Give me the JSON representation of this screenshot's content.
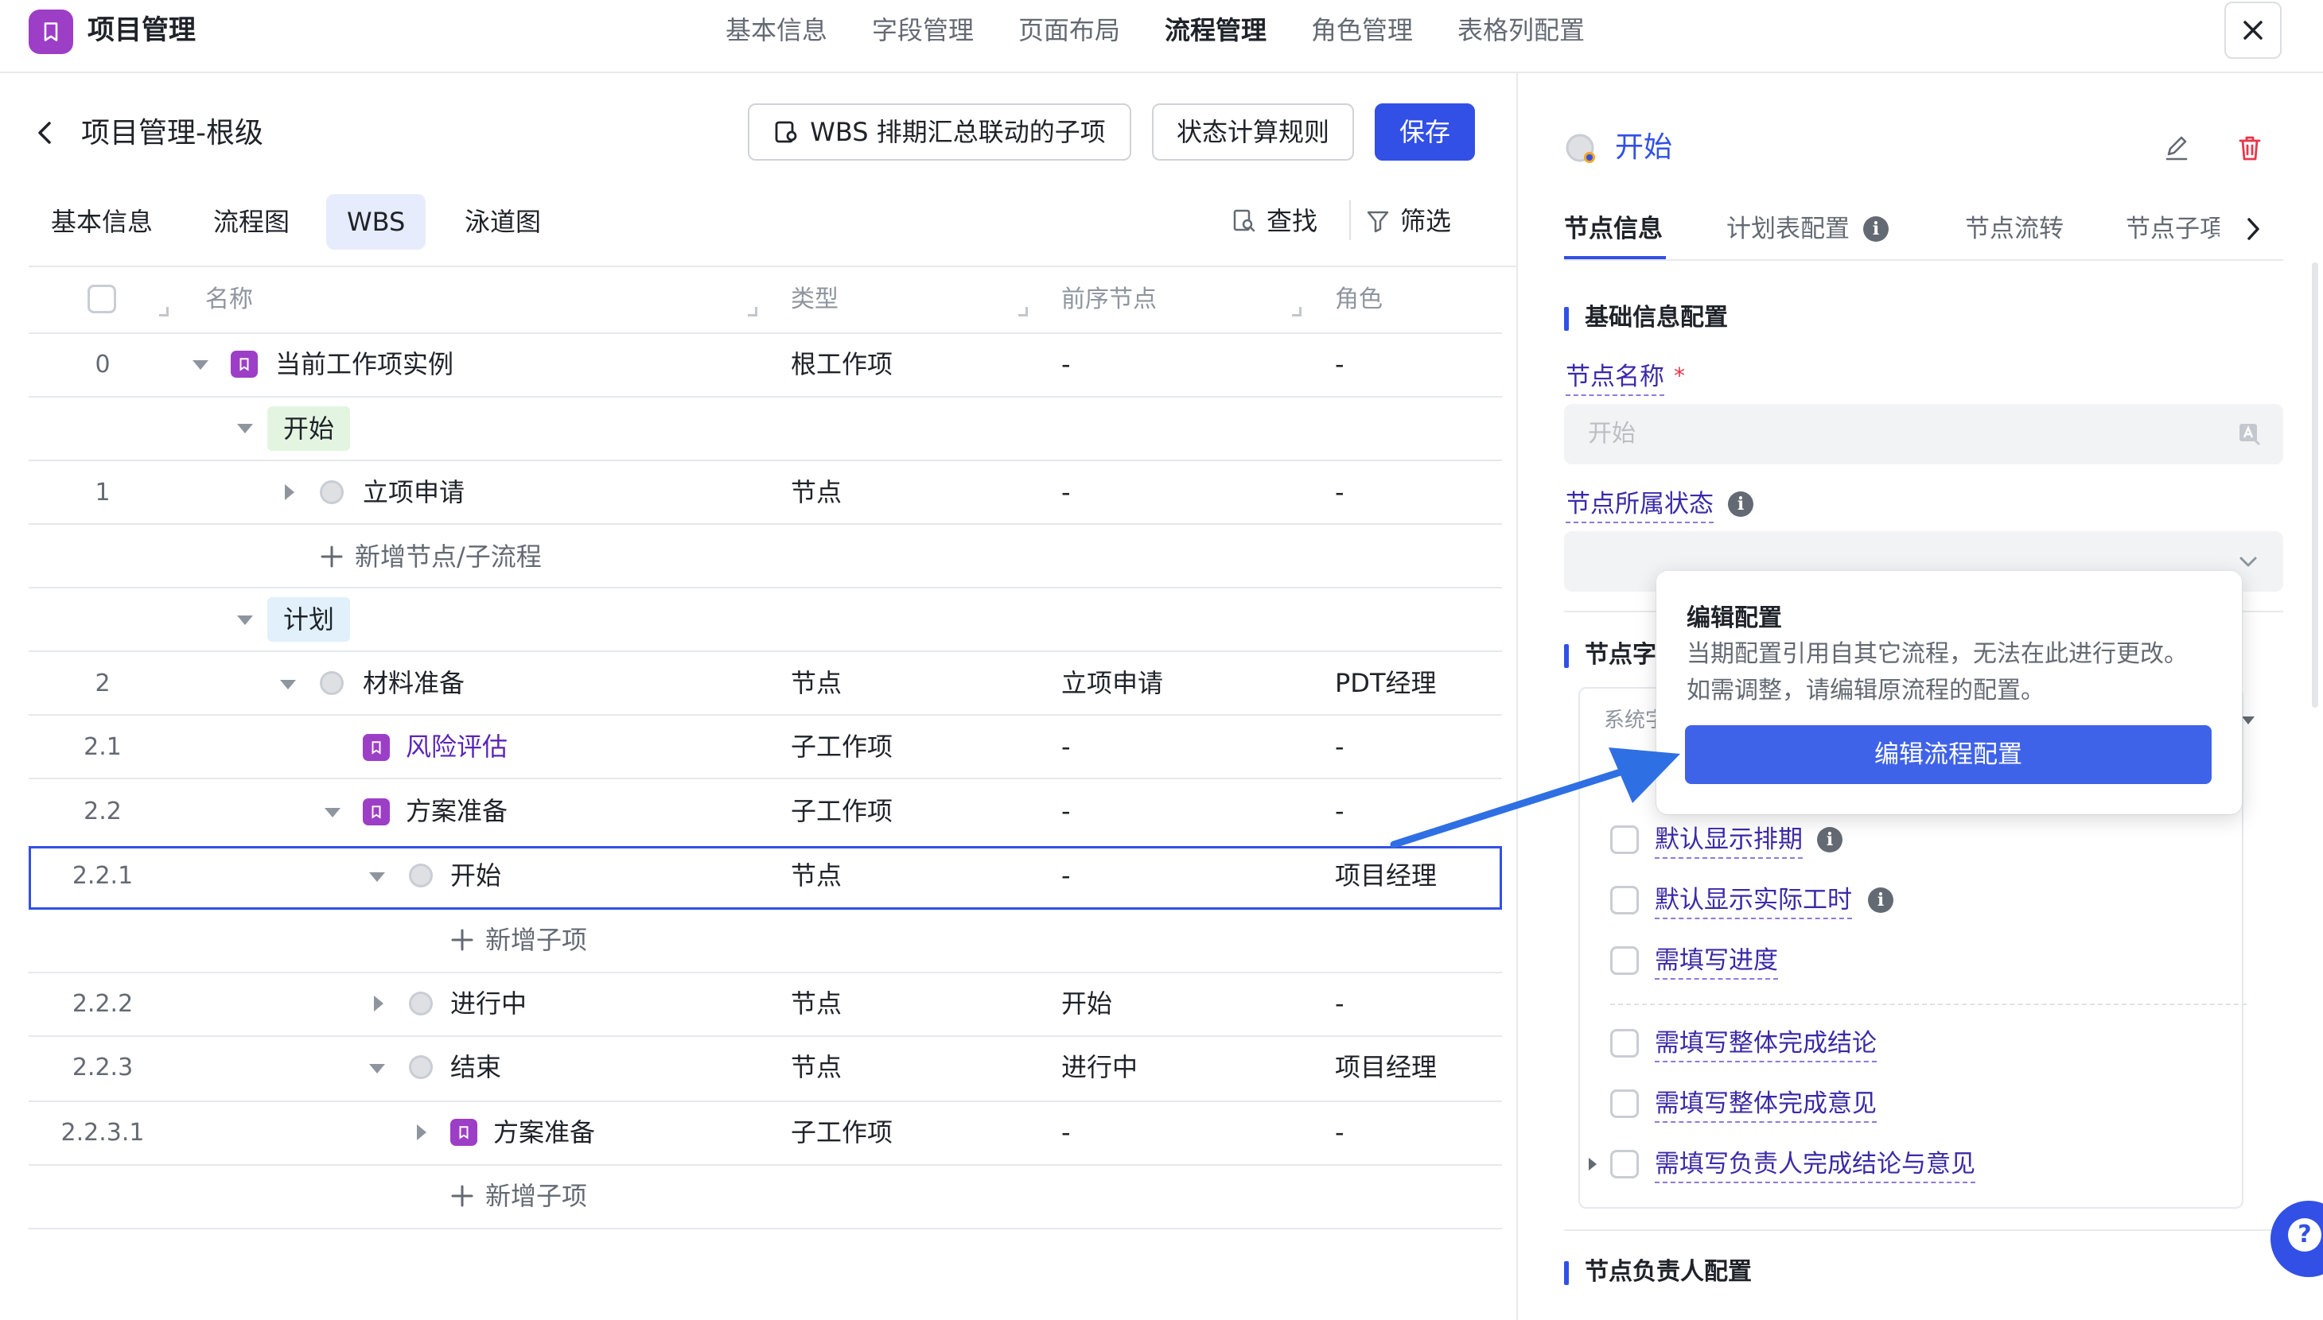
{
  "app": {
    "title": "项目管理"
  },
  "top_tabs": [
    "基本信息",
    "字段管理",
    "页面布局",
    "流程管理",
    "角色管理",
    "表格列配置"
  ],
  "left": {
    "page_title": "项目管理-根级",
    "buttons": {
      "wbs": "WBS 排期汇总联动的子项",
      "status_rule": "状态计算规则",
      "save": "保存"
    },
    "sub_tabs": [
      "基本信息",
      "流程图",
      "WBS",
      "泳道图"
    ],
    "tools": {
      "find": "查找",
      "filter": "筛选"
    },
    "columns": [
      "名称",
      "类型",
      "前序节点",
      "角色"
    ],
    "rows": [
      {
        "idx": "0",
        "name": "当前工作项实例",
        "type": "根工作项",
        "prev": "-",
        "role": "-"
      },
      {
        "tag": "开始"
      },
      {
        "idx": "1",
        "name": "立项申请",
        "type": "节点",
        "prev": "-",
        "role": "-"
      },
      {
        "add": "新增节点/子流程"
      },
      {
        "tag": "计划"
      },
      {
        "idx": "2",
        "name": "材料准备",
        "type": "节点",
        "prev": "立项申请",
        "role": "PDT经理"
      },
      {
        "idx": "2.1",
        "name": "风险评估",
        "type": "子工作项",
        "prev": "-",
        "role": "-"
      },
      {
        "idx": "2.2",
        "name": "方案准备",
        "type": "子工作项",
        "prev": "-",
        "role": "-"
      },
      {
        "idx": "2.2.1",
        "name": "开始",
        "type": "节点",
        "prev": "-",
        "role": "项目经理"
      },
      {
        "add": "新增子项"
      },
      {
        "idx": "2.2.2",
        "name": "进行中",
        "type": "节点",
        "prev": "开始",
        "role": "-"
      },
      {
        "idx": "2.2.3",
        "name": "结束",
        "type": "节点",
        "prev": "进行中",
        "role": "项目经理"
      },
      {
        "idx": "2.2.3.1",
        "name": "方案准备",
        "type": "子工作项",
        "prev": "-",
        "role": "-"
      },
      {
        "add": "新增子项"
      }
    ]
  },
  "right": {
    "title": "开始",
    "tabs": [
      "节点信息",
      "计划表配置",
      "节点流转",
      "节点子項"
    ],
    "section_basic": "基础信息配置",
    "node_name_label": "节点名称",
    "required_mark": "*",
    "node_name_placeholder": "开始",
    "node_status_label": "节点所属状态",
    "section_second": "节点字",
    "card_header": "系统字",
    "checkboxes": [
      "默认显示排期",
      "默认显示实际工时",
      "需填写进度",
      "需填写整体完成结论",
      "需填写整体完成意见",
      "需填写负责人完成结论与意见"
    ],
    "section_owner": "节点负责人配置",
    "help": "?"
  },
  "popover": {
    "title": "编辑配置",
    "text": "当期配置引用自其它流程，无法在此进行更改。如需调整，请编辑原流程的配置。",
    "button": "编辑流程配置"
  },
  "colors": {
    "primary": "#3250e6",
    "workitem": "#9d3ec7",
    "link_purple": "#5a25b8",
    "tag_start_bg": "#e3f5e1",
    "tag_plan_bg": "#e1f0fb"
  }
}
